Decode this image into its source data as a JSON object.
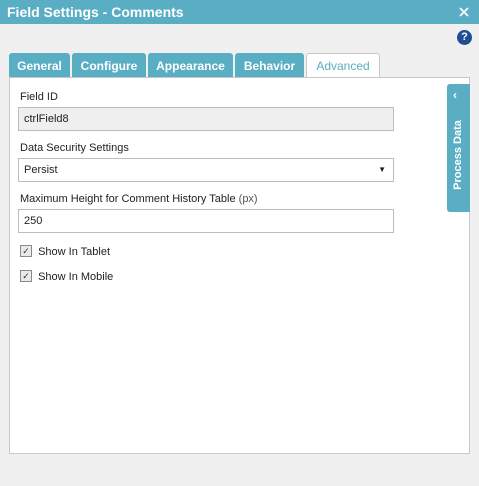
{
  "window": {
    "title": "Field Settings - Comments",
    "help_glyph": "?"
  },
  "tabs": [
    {
      "label": "General"
    },
    {
      "label": "Configure"
    },
    {
      "label": "Appearance"
    },
    {
      "label": "Behavior"
    },
    {
      "label": "Advanced",
      "active": true
    }
  ],
  "form": {
    "field_id_label": "Field ID",
    "field_id_value": "ctrlField8",
    "security_label": "Data Security Settings",
    "security_value": "Persist",
    "max_height_label": "Maximum Height for Comment History Table",
    "max_height_unit": "(px)",
    "max_height_value": "250",
    "show_tablet_label": "Show In Tablet",
    "show_tablet_checked": true,
    "show_mobile_label": "Show In Mobile",
    "show_mobile_checked": true
  },
  "side_panel": {
    "label": "Process Data"
  },
  "colors": {
    "accent": "#5aaec4",
    "help": "#1f4f93"
  }
}
